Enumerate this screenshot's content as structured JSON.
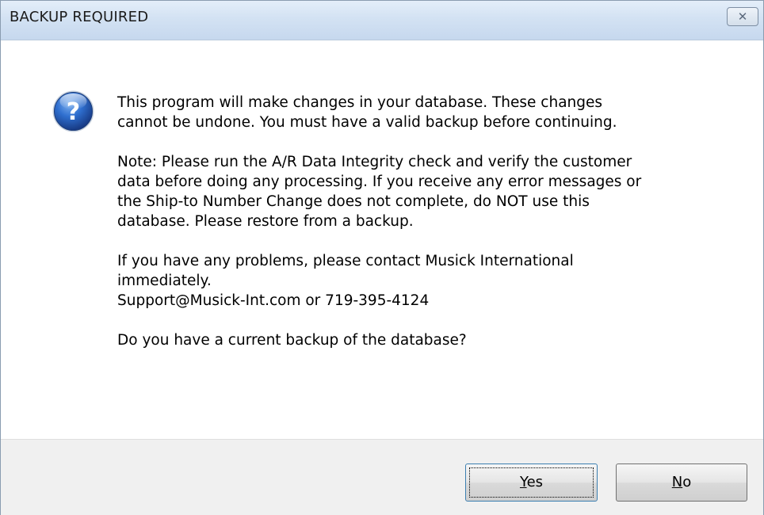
{
  "window": {
    "title": "BACKUP REQUIRED",
    "close_glyph": "✕"
  },
  "icon": "question-icon",
  "message": {
    "paragraph1": [
      "This program will make changes in your database.  These changes",
      "cannot be undone. You must have a valid backup before continuing."
    ],
    "paragraph2": [
      "Note: Please run the A/R Data Integrity check and verify the customer",
      "data before doing any processing.  If you receive any error messages or",
      "the Ship-to Number Change does not complete, do NOT use this",
      "database. Please restore from a backup."
    ],
    "paragraph3": [
      "If you have any problems, please contact Musick International",
      "immediately.",
      "Support@Musick-Int.com or 719-395-4124"
    ],
    "paragraph4": [
      "Do you have a current backup of the database?"
    ]
  },
  "buttons": {
    "yes": {
      "mnemonic": "Y",
      "rest": "es"
    },
    "no": {
      "mnemonic": "N",
      "rest": "o"
    }
  },
  "colors": {
    "titlebar": "#d3e2f3",
    "footer": "#f0f0f0",
    "icon_blue": "#2a5db0"
  }
}
